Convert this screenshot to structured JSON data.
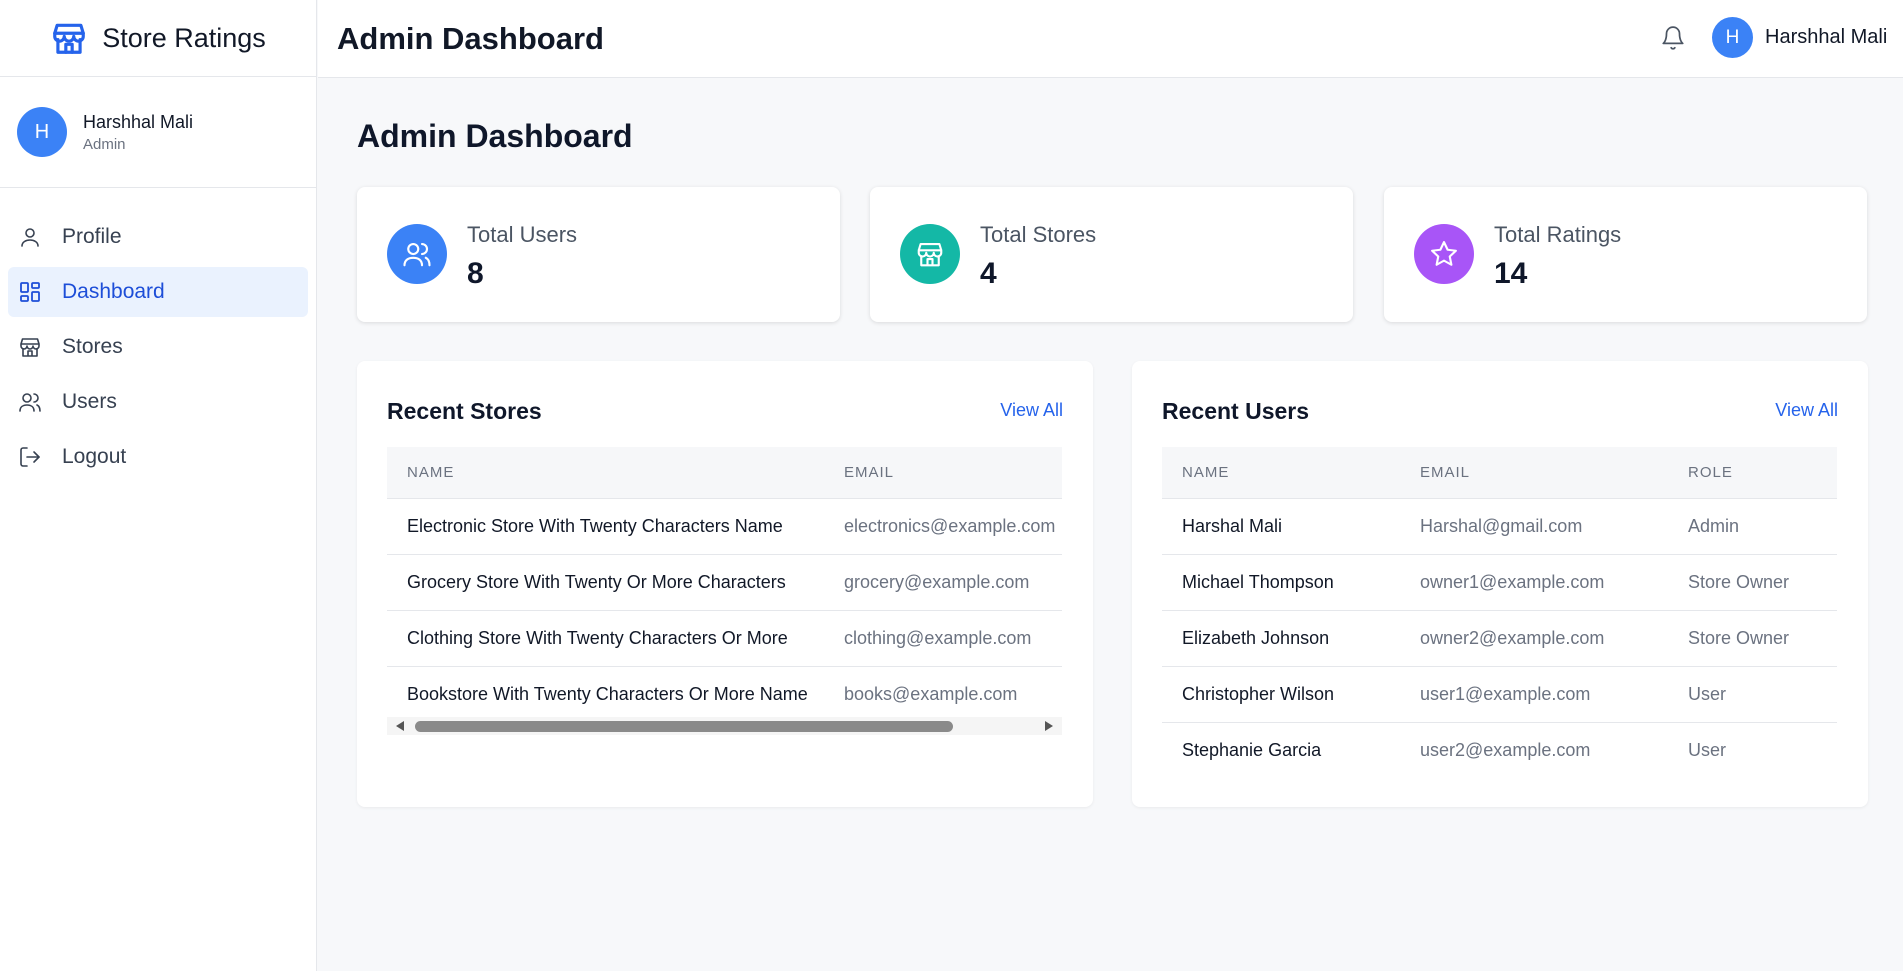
{
  "brand": {
    "title": "Store Ratings"
  },
  "sidebar_user": {
    "initial": "H",
    "name": "Harshhal Mali",
    "role": "Admin"
  },
  "nav": {
    "items": [
      {
        "label": "Profile",
        "icon": "user-icon"
      },
      {
        "label": "Dashboard",
        "icon": "dashboard-icon",
        "active": true
      },
      {
        "label": "Stores",
        "icon": "store-icon"
      },
      {
        "label": "Users",
        "icon": "users-icon"
      },
      {
        "label": "Logout",
        "icon": "logout-icon"
      }
    ]
  },
  "header": {
    "title": "Admin Dashboard",
    "user_initial": "H",
    "user_name": "Harshhal Mali"
  },
  "main": {
    "title": "Admin Dashboard",
    "stats": [
      {
        "label": "Total Users",
        "value": "8",
        "icon": "users-icon",
        "color": "#3b82f6"
      },
      {
        "label": "Total Stores",
        "value": "4",
        "icon": "store-icon",
        "color": "#14b8a6"
      },
      {
        "label": "Total Ratings",
        "value": "14",
        "icon": "star-icon",
        "color": "#a855f7"
      }
    ],
    "recent_stores": {
      "title": "Recent Stores",
      "view_all": "View All",
      "columns": [
        "NAME",
        "EMAIL"
      ],
      "rows": [
        [
          "Electronic Store With Twenty Characters Name",
          "electronics@example.com"
        ],
        [
          "Grocery Store With Twenty Or More Characters",
          "grocery@example.com"
        ],
        [
          "Clothing Store With Twenty Characters Or More",
          "clothing@example.com"
        ],
        [
          "Bookstore With Twenty Characters Or More Name",
          "books@example.com"
        ]
      ]
    },
    "recent_users": {
      "title": "Recent Users",
      "view_all": "View All",
      "columns": [
        "NAME",
        "EMAIL",
        "ROLE"
      ],
      "rows": [
        [
          "Harshal Mali",
          "Harshal@gmail.com",
          "Admin"
        ],
        [
          "Michael Thompson",
          "owner1@example.com",
          "Store Owner"
        ],
        [
          "Elizabeth Johnson",
          "owner2@example.com",
          "Store Owner"
        ],
        [
          "Christopher Wilson",
          "user1@example.com",
          "User"
        ],
        [
          "Stephanie Garcia",
          "user2@example.com",
          "User"
        ]
      ]
    }
  },
  "colors": {
    "accent": "#2563eb",
    "active_bg": "#eaf2fe",
    "avatar": "#3b82f6"
  }
}
